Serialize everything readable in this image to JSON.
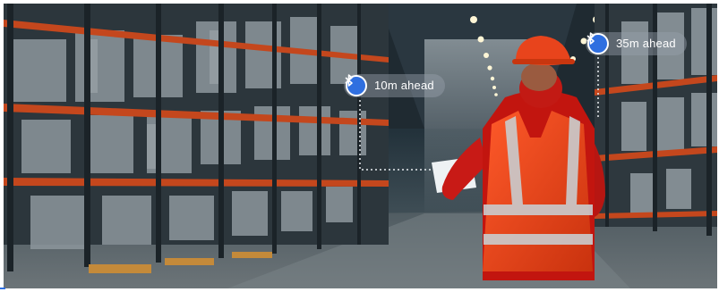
{
  "image": {
    "description_free": true,
    "accent_color": "#2f6fe0",
    "beacons": [
      {
        "label": "10m ahead",
        "icon": "bluetooth-icon"
      },
      {
        "label": "35m ahead",
        "icon": "bluetooth-icon"
      }
    ]
  }
}
